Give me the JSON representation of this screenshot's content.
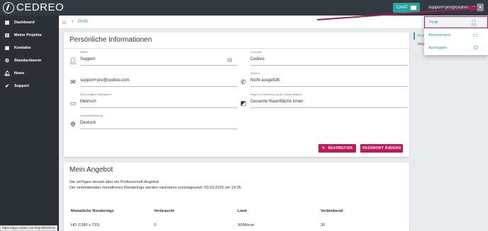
{
  "header": {
    "logo_text": "CEDREO",
    "chat_label": "CHAT",
    "user_email": "support+pro@cedreo.com"
  },
  "sidebar": {
    "items": [
      {
        "label": "Dashboard",
        "icon": "dashboard-icon"
      },
      {
        "label": "Meine Projekte",
        "icon": "projects-icon"
      },
      {
        "label": "Kontakte",
        "icon": "contacts-icon"
      },
      {
        "label": "Standardwerte",
        "icon": "gear-icon"
      },
      {
        "label": "News",
        "icon": "bell-icon"
      },
      {
        "label": "Support",
        "icon": "help-icon"
      }
    ]
  },
  "breadcrumb": {
    "current": "Profil"
  },
  "profile": {
    "title": "Persönliche Informationen",
    "fields": {
      "name_label": "Name",
      "name_value": "Support",
      "vorname_label": "Vorname",
      "vorname_value": "Cedreo",
      "email_value": "support+pro@cedreo.com",
      "telefon_label": "Telefon",
      "telefon_value": "Nicht ausgefüllt",
      "masssystem_label": "Bevorzugtes Maßsystem",
      "masssystem_value": "Metrisch",
      "regel_label": "Regel zur Berechnung der Gesamtfläche",
      "regel_value": "Gesamte Raumfläche innen",
      "sprache_label": "Spracheinstellung",
      "sprache_value": "Deutsch"
    },
    "edit_button": "BEARBEITEN",
    "password_button": "PASSWORT ÄNDERN"
  },
  "angebot": {
    "title": "Mein Angebot",
    "line1": "Sie verfügen derzeit über ein Professionell-Angebot.",
    "line2": "Die verbleibenden monatlichen Renderings werden nächstens zurückgesetzt: 03.03.2025 um 14:35",
    "columns": [
      "Monatliche Renderings",
      "Verbraucht",
      "Limit",
      "Verbleibend"
    ],
    "row": [
      "HD (1280 x 720)",
      "0",
      "30/Monat",
      "30"
    ]
  },
  "right_tabs": {
    "tab1": "Pers",
    "tab2": "Mei"
  },
  "dropdown": {
    "items": [
      {
        "label": "Profil",
        "icon": "person-icon"
      },
      {
        "label": "Abonnement",
        "icon": "card-icon"
      },
      {
        "label": "Ausloggen",
        "icon": "power-icon"
      }
    ]
  },
  "status_url": "https://app.cedreo.com/#/profile/show",
  "colors": {
    "accent": "#26a69a",
    "button": "#c2185b",
    "sidebar": "#2b3036",
    "topbar": "#333a42",
    "annotation": "#b0175e"
  }
}
